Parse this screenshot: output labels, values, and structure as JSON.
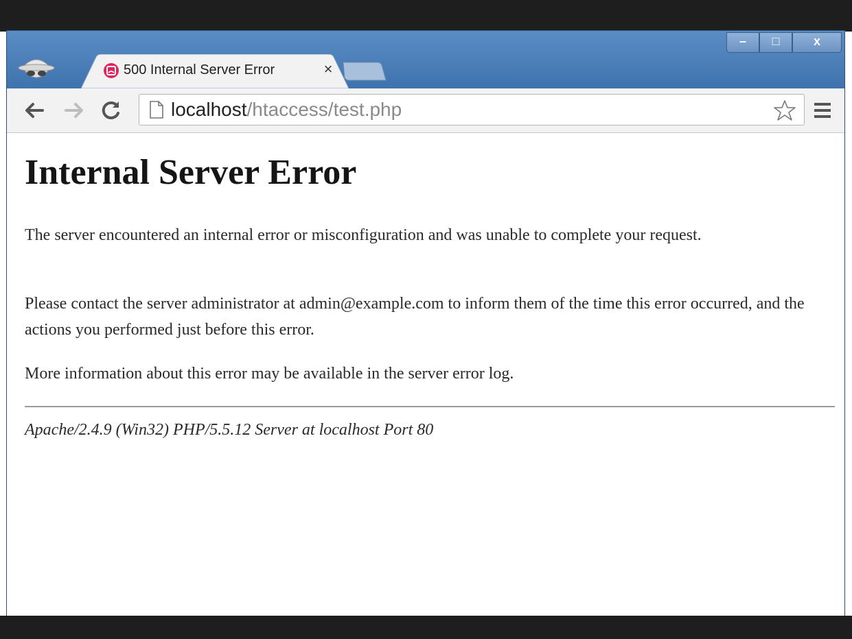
{
  "browser": {
    "tab": {
      "title": "500 Internal Server Error",
      "close_label": "×",
      "favicon": "error-favicon-icon"
    },
    "window_controls": {
      "minimize_label": "–",
      "maximize_label": "□",
      "close_label": "x"
    },
    "toolbar": {
      "url_host": "localhost",
      "url_path": "/htaccess/test.php"
    }
  },
  "page": {
    "heading": "Internal Server Error",
    "paragraph1": "The server encountered an internal error or misconfiguration and was unable to complete your request.",
    "paragraph2": "Please contact the server administrator at admin@example.com to inform them of the time this error occurred, and the actions you performed just before this error.",
    "paragraph3": "More information about this error may be available in the server error log.",
    "server_signature": "Apache/2.4.9 (Win32) PHP/5.5.12 Server at localhost Port 80"
  },
  "colors": {
    "titlebar": "#3f73ad",
    "tab_favicon": "#e0245e"
  }
}
